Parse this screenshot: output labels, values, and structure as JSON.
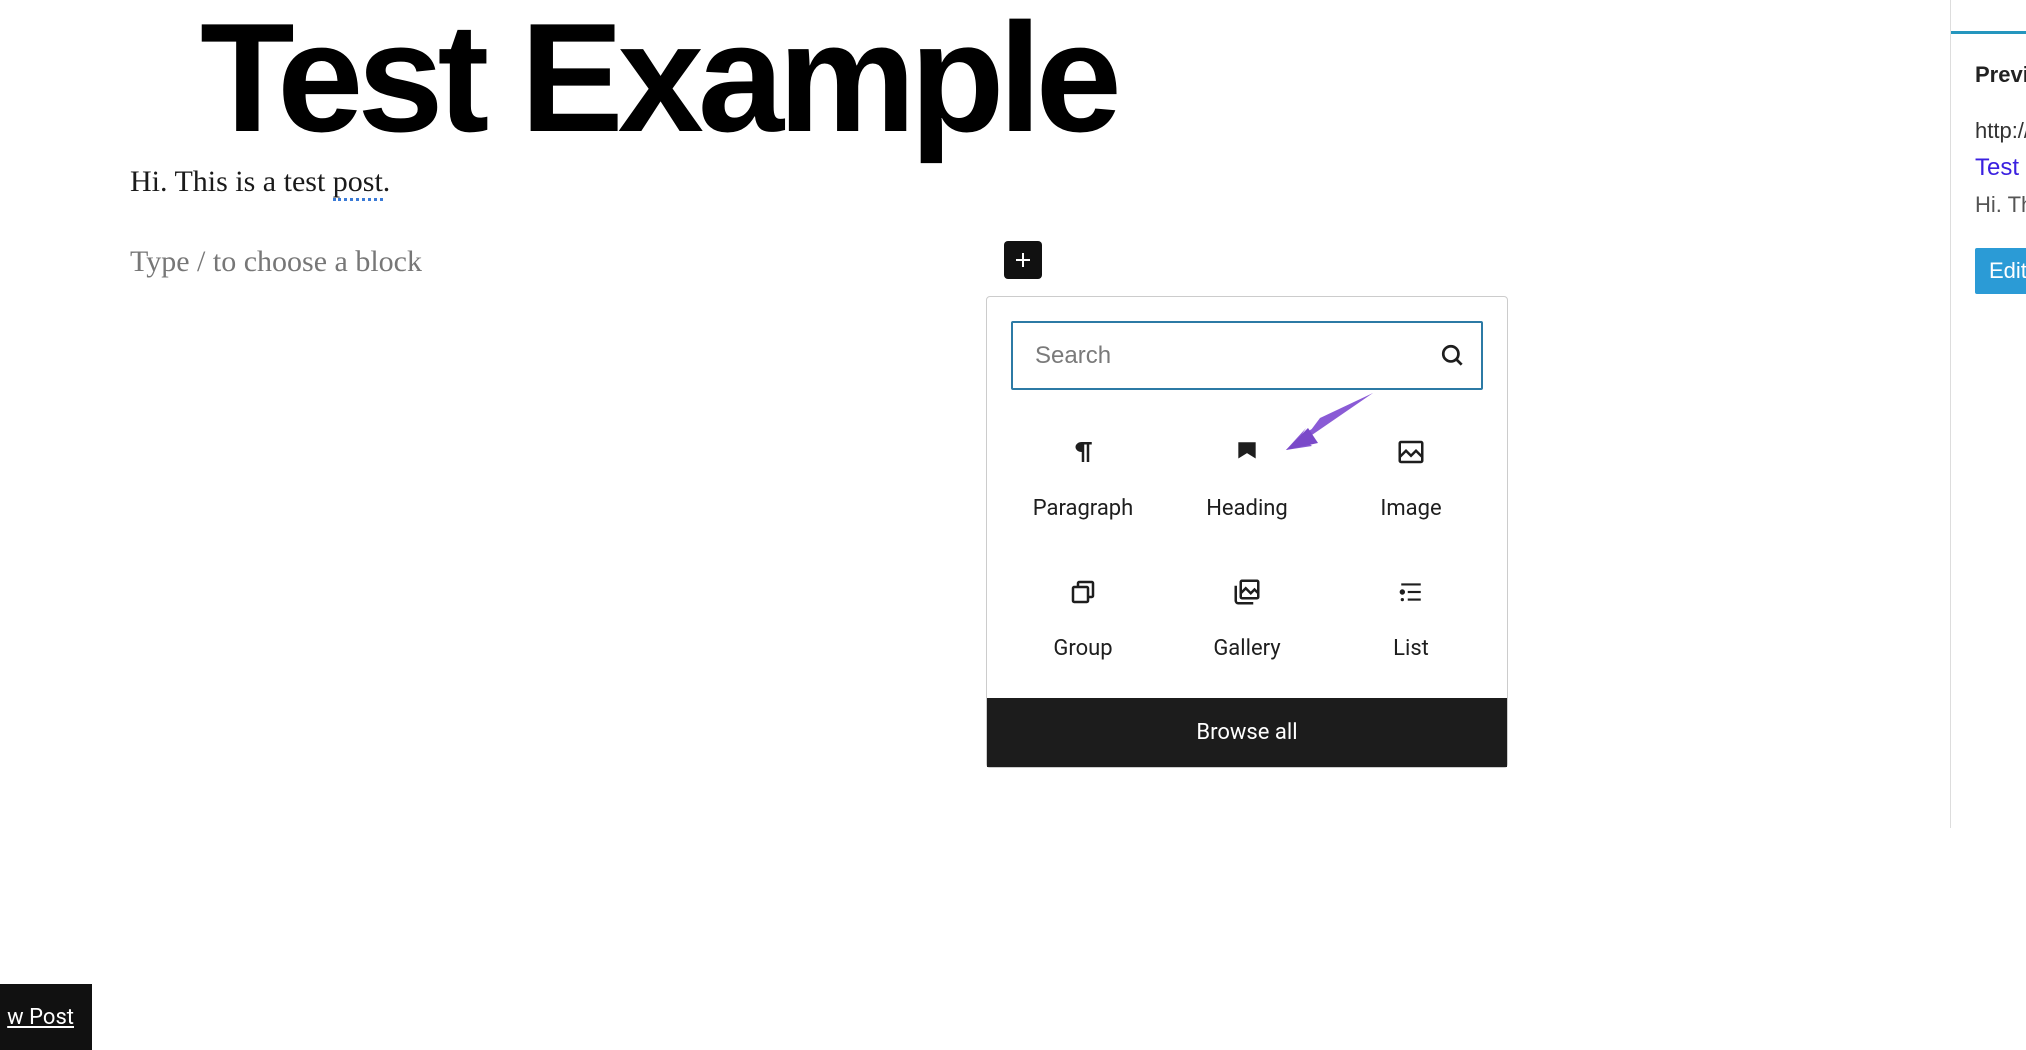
{
  "post": {
    "title": "Test Example",
    "body_prefix": "Hi. This is a test ",
    "body_underlined": "post",
    "body_suffix": ".",
    "placeholder": "Type / to choose a block"
  },
  "inserter": {
    "search_placeholder": "Search",
    "blocks": {
      "paragraph": "Paragraph",
      "heading": "Heading",
      "image": "Image",
      "group": "Group",
      "gallery": "Gallery",
      "list": "List"
    },
    "browse_all": "Browse all"
  },
  "sidebar": {
    "heading": "Previ",
    "url": "http://",
    "title_link": "Test ",
    "excerpt": "Hi. Th",
    "edit_button": "Edit"
  },
  "bottom_button": "w Post",
  "annotation": {
    "arrow_color": "#8a5bd6",
    "target": "heading-block"
  }
}
